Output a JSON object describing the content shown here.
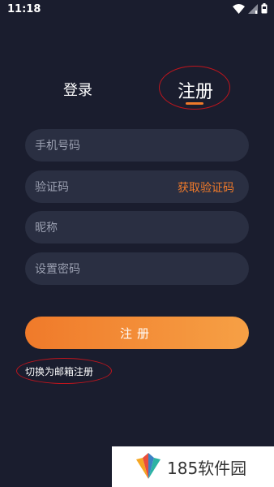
{
  "status_bar": {
    "time": "11:18",
    "icons": [
      "wifi-icon",
      "signal-icon",
      "battery-icon"
    ]
  },
  "tabs": {
    "login_label": "登录",
    "register_label": "注册",
    "active": "register"
  },
  "form": {
    "phone_placeholder": "手机号码",
    "code_placeholder": "验证码",
    "get_code_label": "获取验证码",
    "nickname_placeholder": "昵称",
    "password_placeholder": "设置密码",
    "submit_label": "注册",
    "switch_label": "切换为邮箱注册"
  },
  "watermark": {
    "text": "185软件园"
  },
  "colors": {
    "background": "#1a1d2e",
    "field": "#2a2f42",
    "accent": "#f07a2a",
    "annotation_ring": "#c0151d"
  }
}
